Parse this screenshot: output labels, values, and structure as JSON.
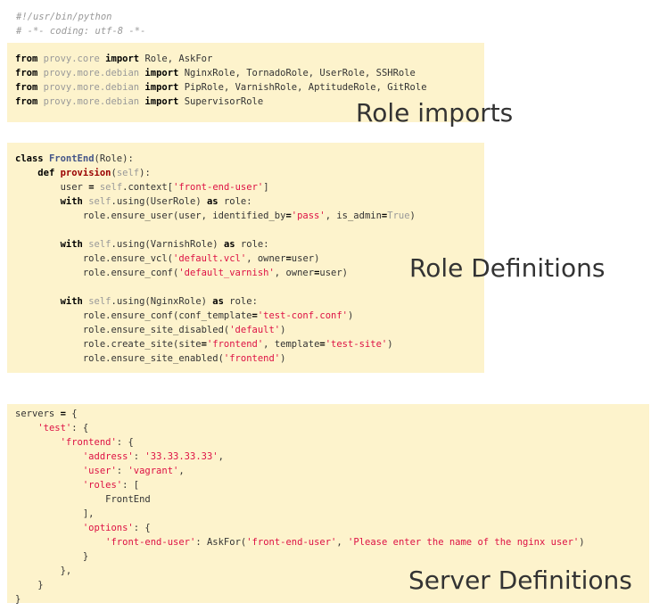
{
  "header": {
    "shebang": "#!/usr/bin/python",
    "coding": "# -*- coding: utf-8 -*-"
  },
  "imports": [
    {
      "kw_from": "from",
      "module": "provy.core",
      "kw_import": "import",
      "names": "Role, AskFor"
    },
    {
      "kw_from": "from",
      "module": "provy.more.debian",
      "kw_import": "import",
      "names": "NginxRole, TornadoRole, UserRole, SSHRole"
    },
    {
      "kw_from": "from",
      "module": "provy.more.debian",
      "kw_import": "import",
      "names": "PipRole, VarnishRole, AptitudeRole, GitRole"
    },
    {
      "kw_from": "from",
      "module": "provy.more.debian",
      "kw_import": "import",
      "names": "SupervisorRole"
    }
  ],
  "role_def": {
    "kw_class": "class",
    "class_name": "FrontEnd",
    "base": "(Role):",
    "kw_def": "def",
    "method": "provision",
    "self": "self",
    "kw_with": "with",
    "kw_as": "as",
    "true": "True",
    "user_var": "user",
    "context_suffix": ".context[",
    "front_end_user": "'front-end-user'",
    "user_role": ".using(UserRole)",
    "varnish_role": ".using(VarnishRole)",
    "nginx_role": ".using(NginxRole)",
    "role_colon": "role:",
    "ensure_user": "role.ensure_user(user, identified_by",
    "pass": "'pass'",
    "is_admin": ", is_admin",
    "ensure_vcl": "role.ensure_vcl(",
    "default_vcl": "'default.vcl'",
    "owner": ", owner",
    "user_close": "user)",
    "ensure_conf": "role.ensure_conf(",
    "default_varnish": "'default_varnish'",
    "conf_template": "role.ensure_conf(conf_template",
    "test_conf": "'test-conf.conf'",
    "site_disabled": "role.ensure_site_disabled(",
    "default_str": "'default'",
    "create_site": "role.create_site(site",
    "frontend_str": "'frontend'",
    "template_kw": ", template",
    "test_site": "'test-site'",
    "site_enabled": "role.ensure_site_enabled("
  },
  "servers": {
    "var": "servers",
    "test": "'test'",
    "frontend": "'frontend'",
    "address_key": "'address'",
    "address_val": "'33.33.33.33'",
    "user_key": "'user'",
    "user_val": "'vagrant'",
    "roles_key": "'roles'",
    "role_item": "FrontEnd",
    "options_key": "'options'",
    "option_key": "'front-end-user'",
    "askfor": "AskFor(",
    "askfor_name": "'front-end-user'",
    "askfor_prompt": "'Please enter the name of the nginx user'"
  },
  "captions": {
    "imports": "Role imports",
    "roles": "Role Definitions",
    "servers": "Server Definitions"
  }
}
